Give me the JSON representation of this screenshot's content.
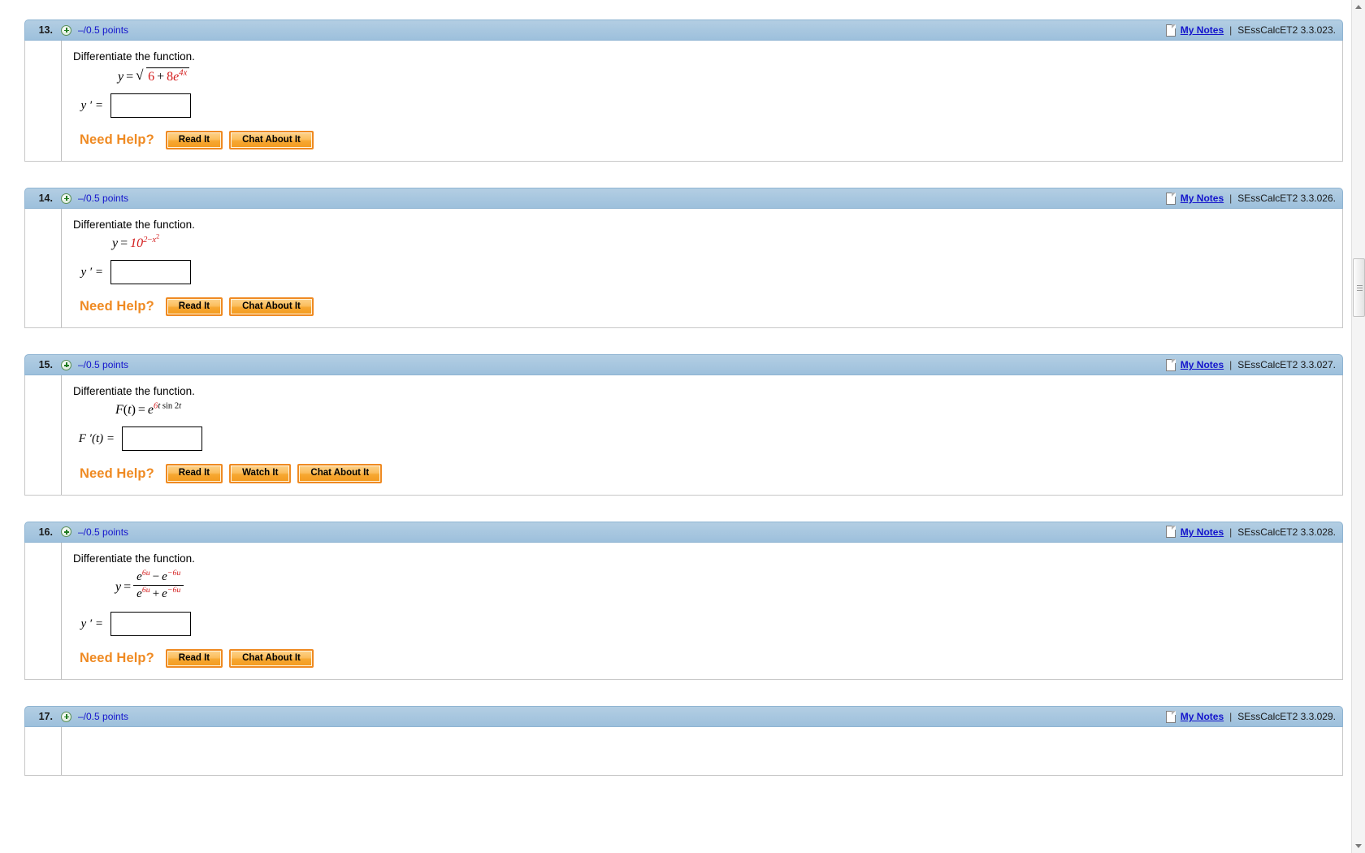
{
  "meta": {
    "my_notes_label": "My Notes",
    "separator": "|",
    "prompt_text": "Differentiate the function.",
    "help_label": "Need Help?",
    "points_text": "–/0.5 points",
    "colors": {
      "header_blue": "#a7c6de",
      "link_blue": "#1414cc",
      "accent_orange": "#ef8a22",
      "math_red": "#d31b1b"
    }
  },
  "questions": [
    {
      "number": "13.",
      "points": "–/0.5 points",
      "reference": "SEssCalcET2 3.3.023.",
      "prompt": "Differentiate the function.",
      "equation_plain": "y = sqrt(6 + 8e^(4x))",
      "answer_label": "y ′ =",
      "answer_value": "",
      "help_buttons": [
        "Read It",
        "Chat About It"
      ]
    },
    {
      "number": "14.",
      "points": "–/0.5 points",
      "reference": "SEssCalcET2 3.3.026.",
      "prompt": "Differentiate the function.",
      "equation_plain": "y = 10^(2 − x^2)",
      "answer_label": "y ′ =",
      "answer_value": "",
      "help_buttons": [
        "Read It",
        "Chat About It"
      ]
    },
    {
      "number": "15.",
      "points": "–/0.5 points",
      "reference": "SEssCalcET2 3.3.027.",
      "prompt": "Differentiate the function.",
      "equation_plain": "F(t) = e^(6t sin 2t)",
      "answer_label": "F ′(t) =",
      "answer_value": "",
      "help_buttons": [
        "Read It",
        "Watch It",
        "Chat About It"
      ]
    },
    {
      "number": "16.",
      "points": "–/0.5 points",
      "reference": "SEssCalcET2 3.3.028.",
      "prompt": "Differentiate the function.",
      "equation_plain": "y = (e^(6u) − e^(−6u)) / (e^(6u) + e^(−6u))",
      "answer_label": "y ′ =",
      "answer_value": "",
      "help_buttons": [
        "Read It",
        "Chat About It"
      ]
    },
    {
      "number": "17.",
      "points": "–/0.5 points",
      "reference": "SEssCalcET2 3.3.029.",
      "prompt": "",
      "equation_plain": "",
      "answer_label": "",
      "answer_value": "",
      "help_buttons": []
    }
  ],
  "scrollbar": {
    "up_arrow": "scroll-up",
    "down_arrow": "scroll-down",
    "thumb": "scroll-thumb"
  }
}
